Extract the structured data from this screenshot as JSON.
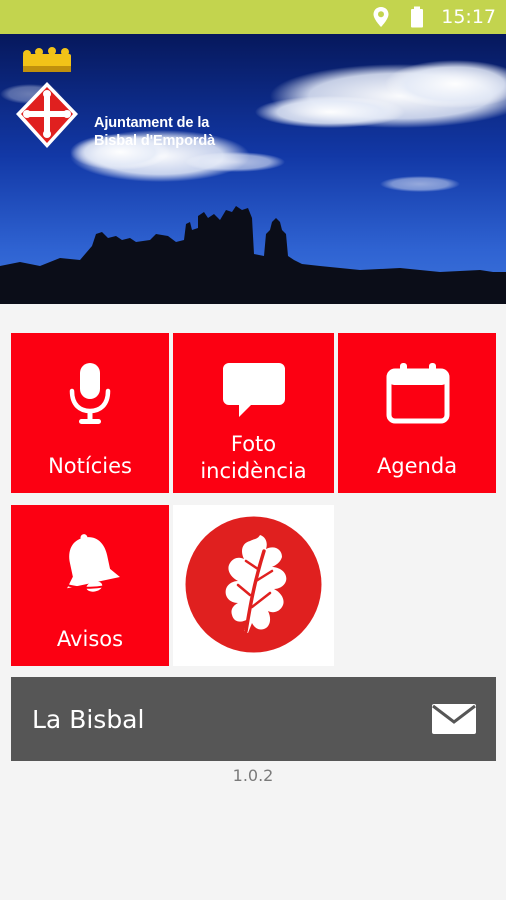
{
  "status_bar": {
    "time": "15:17",
    "icons": [
      "location-pin-icon",
      "battery-icon"
    ],
    "color": "#c3d44e"
  },
  "banner": {
    "title_line1": "Ajuntament de la",
    "title_line2": "Bisbal d'Empordà"
  },
  "tiles": [
    {
      "label": "Notícies",
      "icon": "microphone-icon"
    },
    {
      "label_line1": "Foto",
      "label_line2": "incidència",
      "icon": "speech-bubble-icon"
    },
    {
      "label": "Agenda",
      "icon": "calendar-icon"
    },
    {
      "label": "Avisos",
      "icon": "bell-icon"
    },
    {
      "icon": "oak-leaf-logo-icon"
    }
  ],
  "footer": {
    "title": "La Bisbal",
    "icon": "mail-icon"
  },
  "version": "1.0.2",
  "colors": {
    "tile_red": "#fc0012",
    "footer_gray": "#565656",
    "background": "#f4f4f4"
  }
}
